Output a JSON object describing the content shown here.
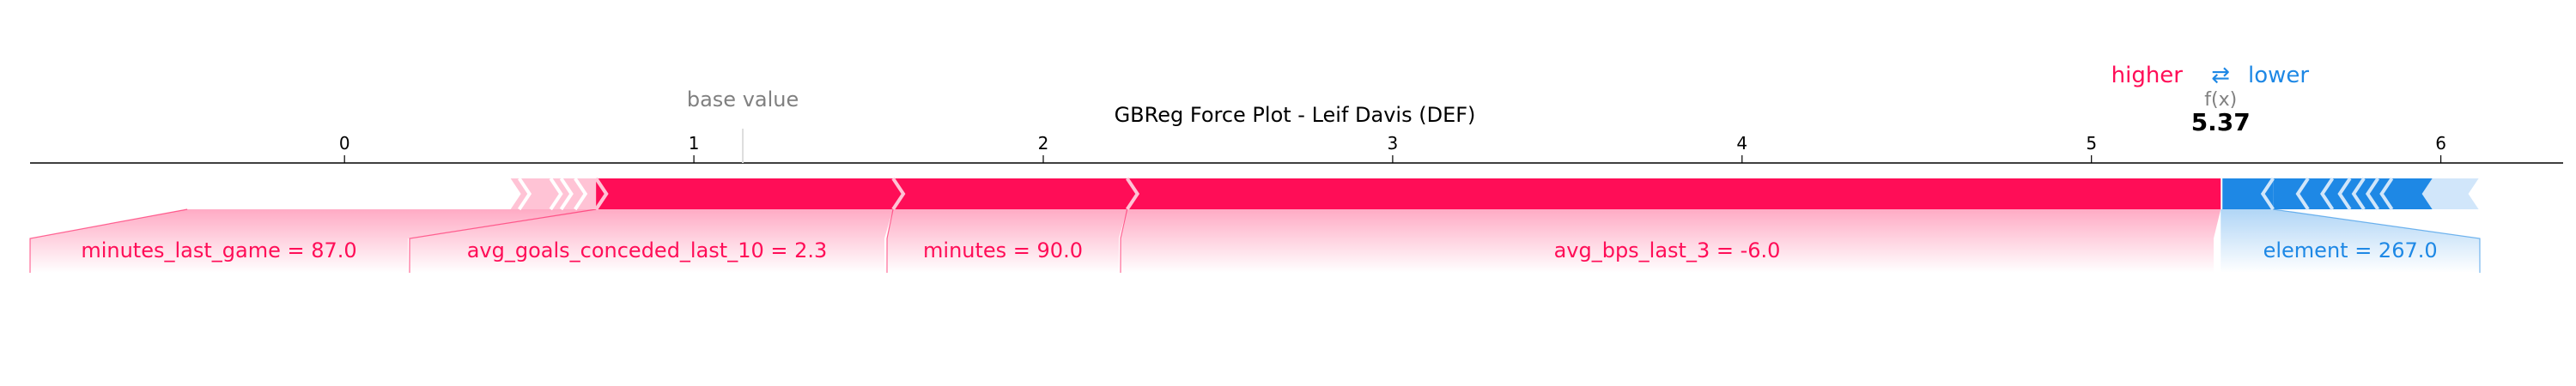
{
  "chart_data": {
    "type": "force",
    "title": "GBReg Force Plot - Leif Davis (DEF)",
    "base_value_label": "base value",
    "base_value": 1.14,
    "output_label": "f(x)",
    "output_value": 5.37,
    "output_text": "5.37",
    "xlim": [
      -0.9,
      6.35
    ],
    "ticks": [
      {
        "value": 0,
        "label": "0"
      },
      {
        "value": 1,
        "label": "1"
      },
      {
        "value": 2,
        "label": "2"
      },
      {
        "value": 3,
        "label": "3"
      },
      {
        "value": 4,
        "label": "4"
      },
      {
        "value": 5,
        "label": "5"
      },
      {
        "value": 6,
        "label": "6"
      }
    ],
    "legend": {
      "higher": "higher",
      "arrow": "⇄",
      "lower": "lower"
    },
    "colors": {
      "positive": "#ff0d57",
      "negative": "#1e88e5",
      "positive_light": "#ffc3d5",
      "negative_light": "#d1e6fa",
      "axis": "#000000",
      "muted": "#808080"
    },
    "positive_features": [
      {
        "label": "avg_bps_last_3 = -6.0",
        "start": 2.24,
        "end": 5.37
      },
      {
        "label": "minutes = 90.0",
        "start": 1.57,
        "end": 2.24
      },
      {
        "label": "avg_goals_conceded_last_10 = 2.3",
        "start": 0.72,
        "end": 1.57
      },
      {
        "label": "minutes_last_game = 87.0",
        "start": -0.45,
        "end": 0.72
      }
    ],
    "minor_positive_boundaries": [
      0.62,
      0.66,
      0.5,
      0.59
    ],
    "positive_minor_start": 0.5,
    "negative_features": [
      {
        "label": "element = 267.0",
        "start": 5.37,
        "end": 5.52
      }
    ],
    "minor_negative_boundaries": [
      5.62,
      5.69,
      5.74,
      5.78,
      5.82,
      5.86
    ],
    "negative_minor_end": 6.0
  }
}
